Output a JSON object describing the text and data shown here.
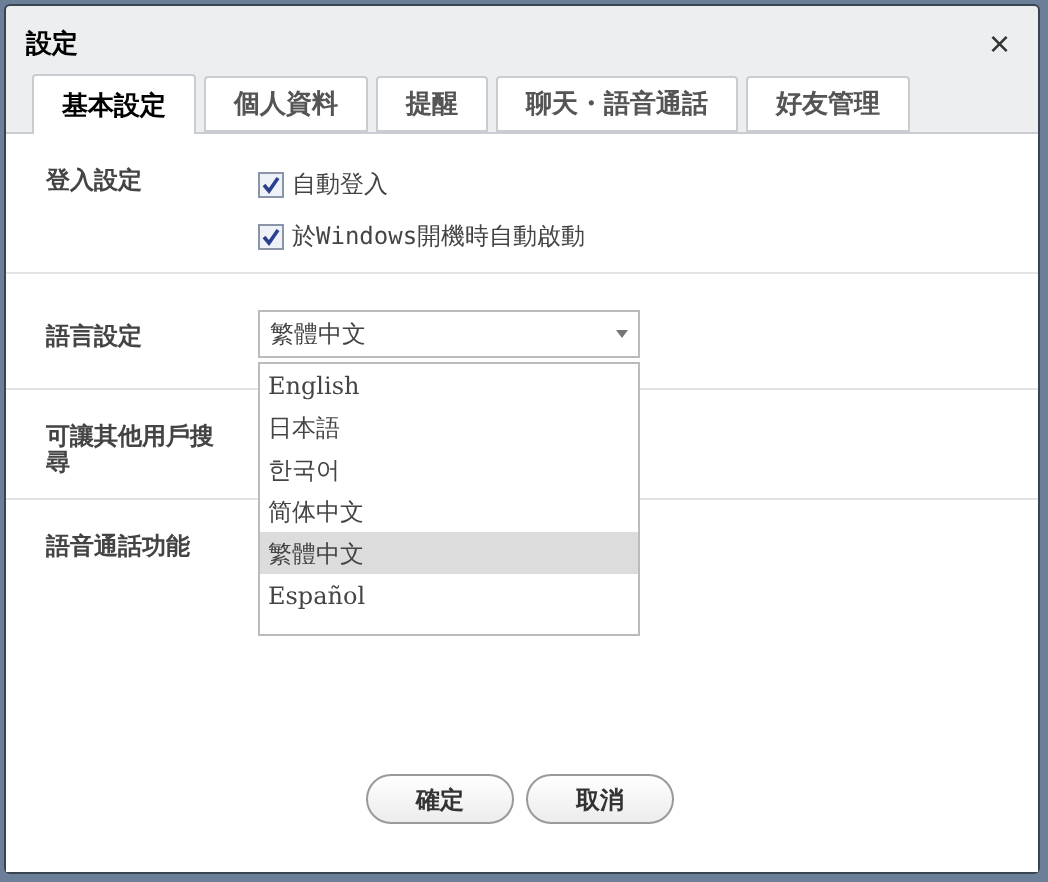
{
  "window": {
    "title": "設定",
    "close": "×"
  },
  "tabs": [
    {
      "label": "基本設定",
      "selected": true
    },
    {
      "label": "個人資料",
      "selected": false
    },
    {
      "label": "提醒",
      "selected": false
    },
    {
      "label": "聊天・語音通話",
      "selected": false
    },
    {
      "label": "好友管理",
      "selected": false
    }
  ],
  "sections": [
    {
      "label": "登入設定",
      "kind": "checkboxes",
      "options": [
        {
          "label": "自動登入",
          "checked": true
        },
        {
          "label": "於Windows開機時自動啟動",
          "checked": true
        }
      ]
    },
    {
      "label": "語言設定",
      "kind": "dropdown",
      "value": "繁體中文",
      "expanded": true,
      "options": [
        {
          "label": "English",
          "selected": false
        },
        {
          "label": "日本語",
          "selected": false
        },
        {
          "label": "한국어",
          "selected": false
        },
        {
          "label": "简体中文",
          "selected": false
        },
        {
          "label": "繁體中文",
          "selected": true
        },
        {
          "label": "Español",
          "selected": false
        }
      ]
    },
    {
      "label": "可讓其他用戶搜尋",
      "kind": "hidden"
    },
    {
      "label": "語音通話功能",
      "kind": "hidden"
    }
  ],
  "buttons": [
    "確定",
    "取消"
  ]
}
